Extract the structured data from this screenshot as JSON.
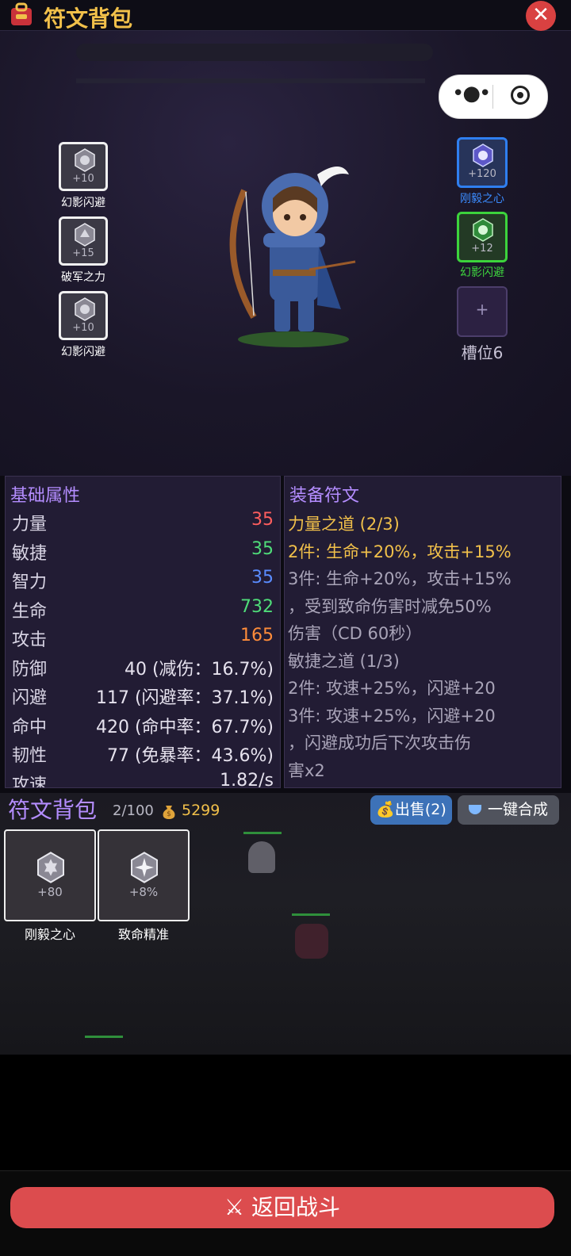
{
  "header": {
    "title": "符文背包",
    "close_glyph": "✕"
  },
  "hero_slots_left": [
    {
      "bonus": "+10",
      "name": "幻影闪避"
    },
    {
      "bonus": "+15",
      "name": "破军之力"
    },
    {
      "bonus": "+10",
      "name": "幻影闪避"
    }
  ],
  "hero_slots_right": [
    {
      "bonus": "+120",
      "name": "刚毅之心",
      "quality": "blue"
    },
    {
      "bonus": "+12",
      "name": "幻影闪避",
      "quality": "green"
    }
  ],
  "empty_slot": {
    "plus": "+",
    "label": "槽位6"
  },
  "stats_panel": {
    "title": "基础属性",
    "rows": [
      {
        "name": "力量",
        "value": "35",
        "color": "#ff5e5e"
      },
      {
        "name": "敏捷",
        "value": "35",
        "color": "#4fdc79"
      },
      {
        "name": "智力",
        "value": "35",
        "color": "#5a8cff"
      },
      {
        "name": "生命",
        "value": "732",
        "color": "#4fdc79"
      },
      {
        "name": "攻击",
        "value": "165",
        "color": "#ff8c3a"
      },
      {
        "name": "防御",
        "value": "40 (减伤：16.7%)",
        "color": "#e6e2ee"
      },
      {
        "name": "闪避",
        "value": "117 (闪避率：37.1%)",
        "color": "#e6e2ee"
      },
      {
        "name": "命中",
        "value": "420 (命中率：67.7%)",
        "color": "#e6e2ee"
      },
      {
        "name": "韧性",
        "value": "77 (免暴率：43.6%)",
        "color": "#e6e2ee"
      },
      {
        "name": "攻速",
        "value": "1.82/s",
        "color": "#e6e2ee"
      }
    ]
  },
  "runes_panel": {
    "title": "装备符文",
    "lines": [
      {
        "text": "力量之道 (2/3)",
        "color": "#f1c04a"
      },
      {
        "text": " 2件: 生命+20%，攻击+15%",
        "color": "#f1c04a"
      },
      {
        "text": "3件: 生命+20%，攻击+15%",
        "color": "#a9a4b8"
      },
      {
        "text": "，受到致命伤害时减免50%",
        "color": "#a9a4b8"
      },
      {
        "text": "伤害（CD 60秒）",
        "color": "#a9a4b8"
      },
      {
        "text": "敏捷之道 (1/3)",
        "color": "#a9a4b8"
      },
      {
        "text": " 2件: 攻速+25%，闪避+20",
        "color": "#a9a4b8"
      },
      {
        "text": "3件: 攻速+25%，闪避+20",
        "color": "#a9a4b8"
      },
      {
        "text": "，闪避成功后下次攻击伤",
        "color": "#a9a4b8"
      },
      {
        "text": "害x2",
        "color": "#a9a4b8"
      }
    ]
  },
  "inventory": {
    "title": "符文背包",
    "count": "2/100",
    "gold": "5299",
    "sell_label": "出售(2)",
    "merge_label": "一键合成",
    "items": [
      {
        "bonus": "+80",
        "name": "刚毅之心"
      },
      {
        "bonus": "+8%",
        "name": "致命精准"
      }
    ]
  },
  "back_button": {
    "label": "返回战斗"
  },
  "colors": {
    "accent_gold": "#f1c04a",
    "accent_purple": "#b48dff",
    "danger_red": "#dc4c4e"
  }
}
